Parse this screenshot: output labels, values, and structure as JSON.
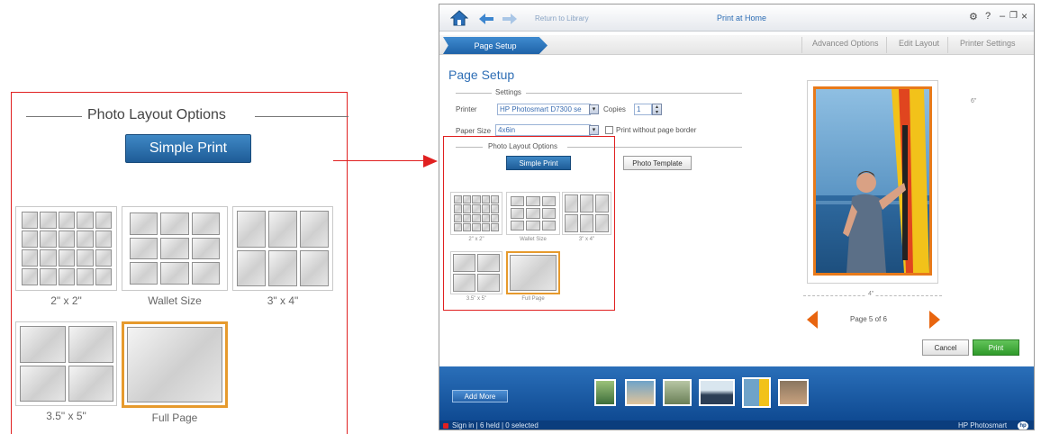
{
  "callout": {
    "title": "Photo Layout Options",
    "simple_print_label": "Simple Print",
    "layouts": [
      {
        "label": "2\" x 2\""
      },
      {
        "label": "Wallet Size"
      },
      {
        "label": "3\" x 4\""
      },
      {
        "label": "3.5\" x 5\""
      },
      {
        "label": "Full Page",
        "selected": true
      }
    ]
  },
  "app": {
    "nav": {
      "return_label": "Return to Library"
    },
    "window_title": "Print at Home",
    "window_controls": {
      "settings": "⚙",
      "help": "?",
      "minimize": "–",
      "maximize": "❐",
      "close": "×"
    },
    "tabs": {
      "active": "Page Setup",
      "others": [
        "Advanced Options",
        "Edit Layout",
        "Printer Settings"
      ]
    },
    "page_title": "Page Setup",
    "settings": {
      "section_label": "Settings",
      "printer_label": "Printer",
      "printer_value": "HP Photosmart D7300 se",
      "copies_label": "Copies",
      "copies_value": "1",
      "paper_size_label": "Paper Size",
      "paper_size_value": "4x6in",
      "border_checkbox_label": "Print without page border",
      "border_checked": false
    },
    "layout_options": {
      "section_label": "Photo Layout Options",
      "simple_print_label": "Simple Print",
      "photo_template_label": "Photo Template",
      "layouts": [
        "2\" x 2\"",
        "Wallet Size",
        "3\" x 4\"",
        "3.5\" x 5\"",
        "Full Page"
      ]
    },
    "preview": {
      "height_label": "6\"",
      "width_label": "4\"",
      "page_indicator": "Page 5 of 6",
      "current_page": 5,
      "total_pages": 6
    },
    "buttons": {
      "cancel": "Cancel",
      "print": "Print"
    },
    "bottom": {
      "add_more": "Add More",
      "status": "Sign in | 6 held | 0 selected",
      "brand": "HP Photosmart",
      "brand_logo": "hp"
    },
    "colors": {
      "accent_blue": "#1f63a8",
      "selected_orange": "#e69a2d",
      "print_green": "#3aa83a",
      "callout_red": "#e02020",
      "nav_arrow_orange": "#e8650f"
    }
  }
}
